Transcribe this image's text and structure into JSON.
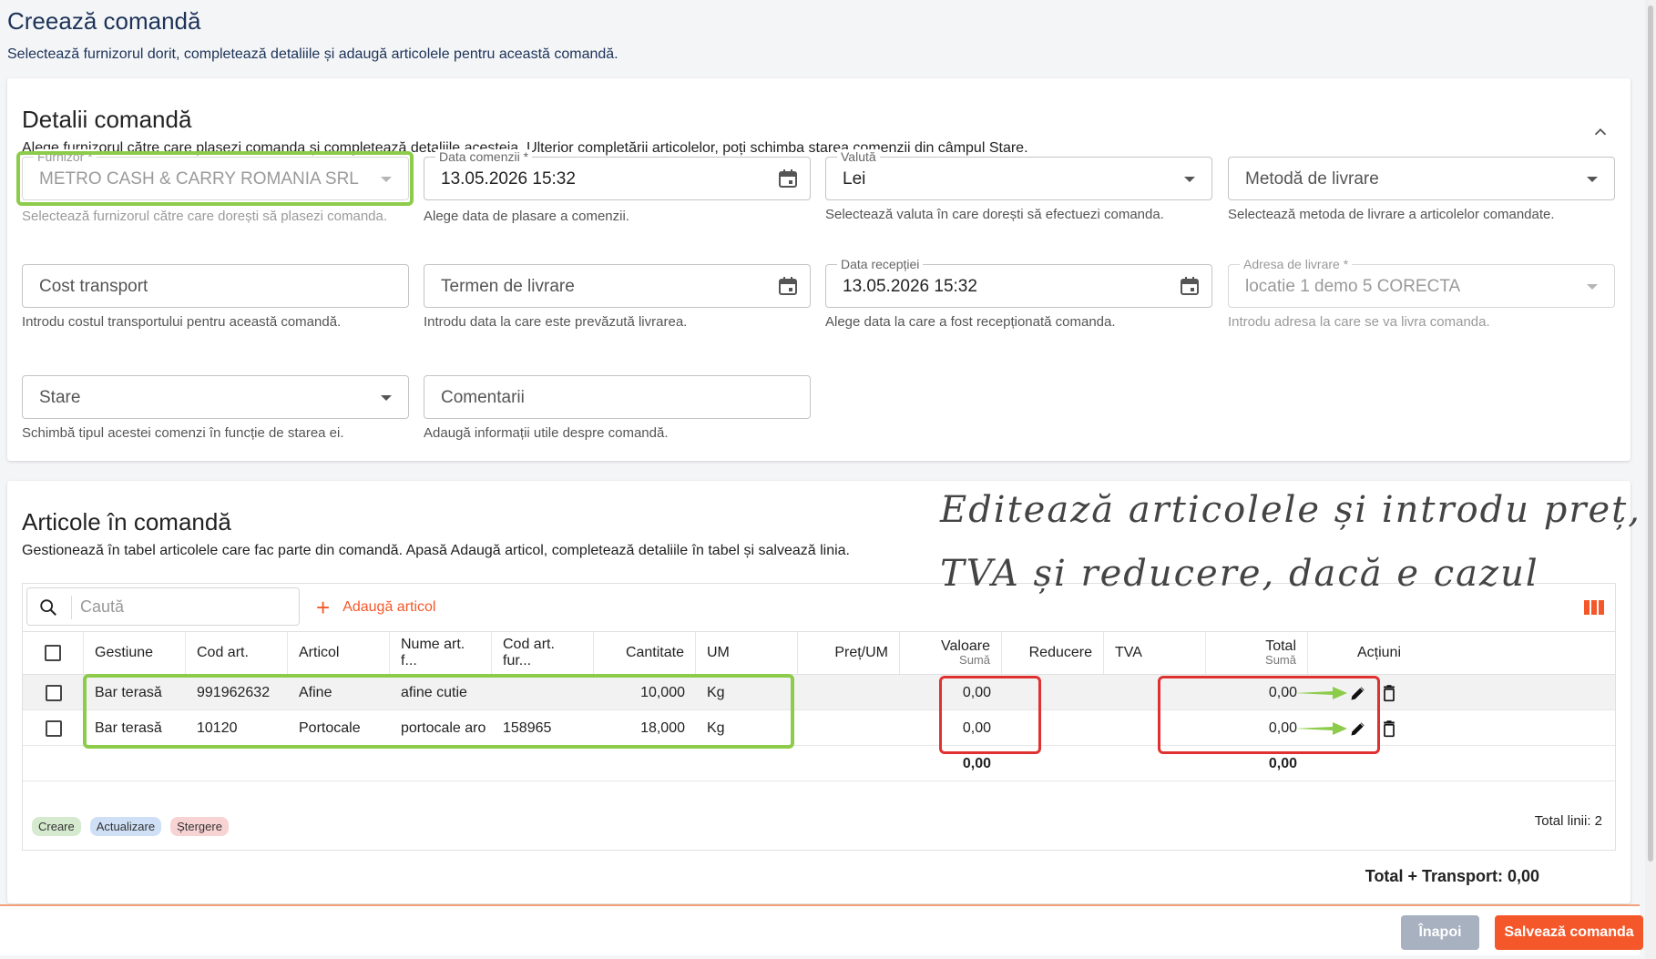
{
  "page": {
    "title": "Creează comandă",
    "subtitle": "Selectează furnizorul dorit, completează detaliile și adaugă articolele pentru această comandă."
  },
  "details": {
    "title": "Detalii comandă",
    "description": "Alege furnizorul către care plasezi comanda și completează detaliile acesteia. Ulterior completării articolelor, poți schimba starea comenzii din câmpul Stare.",
    "supplier": {
      "label": "Furnizor *",
      "value": "METRO CASH & CARRY ROMANIA SRL",
      "helper": "Selectează furnizorul către care dorești să plasezi comanda."
    },
    "order_date": {
      "label": "Data comenzii *",
      "value": "13.05.2026 15:32",
      "helper": "Alege data de plasare a comenzii."
    },
    "currency": {
      "label": "Valută",
      "value": "Lei",
      "helper": "Selectează valuta în care dorești să efectuezi comanda."
    },
    "delivery_method": {
      "placeholder": "Metodă de livrare",
      "helper": "Selectează metoda de livrare a articolelor comandate."
    },
    "transport_cost": {
      "placeholder": "Cost transport",
      "helper": "Introdu costul transportului pentru această comandă."
    },
    "delivery_term": {
      "placeholder": "Termen de livrare",
      "helper": "Introdu data la care este prevăzută livrarea."
    },
    "reception_date": {
      "label": "Data recepției",
      "value": "13.05.2026 15:32",
      "helper": "Alege data la care a fost recepționată comanda."
    },
    "delivery_address": {
      "label": "Adresa de livrare *",
      "value": "locatie 1 demo 5 CORECTA",
      "helper": "Introdu adresa la care se va livra comanda."
    },
    "status": {
      "placeholder": "Stare",
      "helper": "Schimbă tipul acestei comenzi în funcție de starea ei."
    },
    "comments": {
      "placeholder": "Comentarii",
      "helper": "Adaugă informații utile despre comandă."
    }
  },
  "articles": {
    "title": "Articole în comandă",
    "description": "Gestionează în tabel articolele care fac parte din comandă. Apasă Adaugă articol, completează detaliile în tabel și salvează linia.",
    "search_placeholder": "Caută",
    "add_label": "Adaugă articol",
    "columns": {
      "gestiune": "Gestiune",
      "cod_art": "Cod art.",
      "articol": "Articol",
      "nume_art": "Nume art. f...",
      "cod_art_fur": "Cod art. fur...",
      "cantitate": "Cantitate",
      "um": "UM",
      "pret": "Preț/UM",
      "valoare": "Valoare",
      "valoare_sub": "Sumă",
      "reducere": "Reducere",
      "tva": "TVA",
      "total": "Total",
      "total_sub": "Sumă",
      "actiuni": "Acțiuni"
    },
    "rows": [
      {
        "gestiune": "Bar terasă",
        "cod_art": "991962632",
        "articol": "Afine",
        "nume_art": "afine cutie",
        "cod_art_fur": "",
        "cantitate": "10,000",
        "um": "Kg",
        "pret": "",
        "valoare": "0,00",
        "reducere": "",
        "tva": "",
        "total": "0,00"
      },
      {
        "gestiune": "Bar terasă",
        "cod_art": "10120",
        "articol": "Portocale",
        "nume_art": "portocale aro",
        "cod_art_fur": "158965",
        "cantitate": "18,000",
        "um": "Kg",
        "pret": "",
        "valoare": "0,00",
        "reducere": "",
        "tva": "",
        "total": "0,00"
      }
    ],
    "totals": {
      "valoare": "0,00",
      "total": "0,00"
    },
    "legend": {
      "create": "Creare",
      "update": "Actualizare",
      "delete": "Ștergere"
    },
    "total_lines": "Total linii: 2",
    "grand_total": "Total + Transport: 0,00"
  },
  "annotation": {
    "line1": "Editează articolele și introdu preț,",
    "line2": "TVA și reducere, dacă e cazul"
  },
  "footer": {
    "back_label": "Înapoi",
    "save_label": "Salvează comanda"
  },
  "colors": {
    "accent": "#f4582a",
    "highlight_green": "#8ccc4a",
    "highlight_red": "#e03131",
    "title": "#1c3358"
  },
  "icons": [
    "chevron-up-icon",
    "calendar-icon",
    "caret-down-icon",
    "search-icon",
    "plus-icon",
    "columns-icon",
    "pencil-icon",
    "trash-icon",
    "arrow-icon"
  ]
}
